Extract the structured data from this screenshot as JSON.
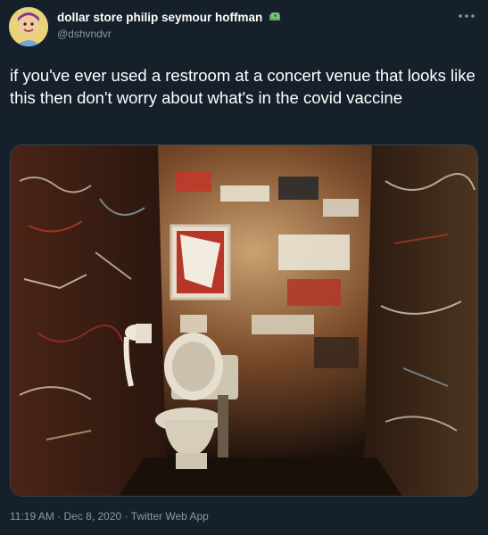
{
  "author": {
    "display_name": "dollar store philip seymour hoffman",
    "name_emoji_icon": "money-bag-icon",
    "handle": "@dshvndvr",
    "avatar_icon": "cartoon-face-avatar"
  },
  "tweet": {
    "text": "if you've ever used a restroom at a concert venue that looks like this then don't worry about what's in the covid vaccine"
  },
  "media": {
    "type": "photo",
    "scene_icon": "graffiti-restroom-photo"
  },
  "meta": {
    "time": "11:19 AM",
    "separator1": " · ",
    "date": "Dec 8, 2020",
    "separator2": " · ",
    "source": "Twitter Web App"
  },
  "icons": {
    "more": "more-dots-icon"
  },
  "colors": {
    "background": "#15202b",
    "secondary_text": "#8899a6",
    "border": "#38444d"
  }
}
